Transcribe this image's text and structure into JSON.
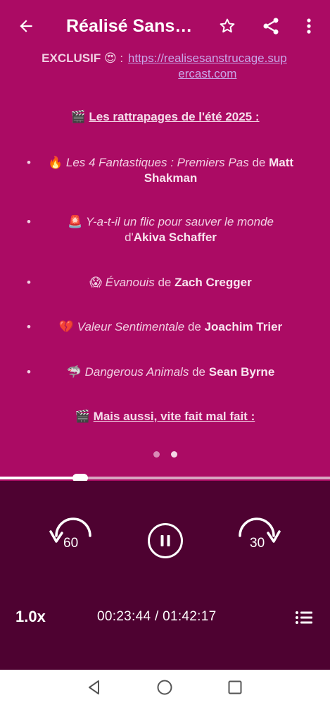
{
  "header": {
    "title": "Réalisé Sans Trucage",
    "back_icon": "arrow-left-icon",
    "favorite_icon": "star-outline-icon",
    "share_icon": "share-icon",
    "more_icon": "more-vertical-icon"
  },
  "description": {
    "exclusive_label": "EXCLUSIF 😍",
    "exclusive_sep": " : ",
    "link_text": "https://realisesanstrucage.supercast.com",
    "heading_emoji": "🎬",
    "heading": "Les rattrapages de l'été 2025 :",
    "items": [
      {
        "emoji": "🔥",
        "title": "Les 4 Fantastiques : Premiers Pas",
        "connector": "de",
        "director": "Matt Shakman"
      },
      {
        "emoji": "🚨",
        "title": "Y-a-t-il un flic pour sauver le monde",
        "connector": "d'",
        "director": "Akiva Schaffer"
      },
      {
        "emoji": "😱",
        "title": "Évanouis",
        "connector": "de",
        "director": "Zach Cregger"
      },
      {
        "emoji": "💔",
        "title": "Valeur Sentimentale",
        "connector": "de",
        "director": "Joachim Trier"
      },
      {
        "emoji": "🦈",
        "title": "Dangerous Animals",
        "connector": "de",
        "director": "Sean Byrne"
      }
    ],
    "heading2_emoji": "🎬",
    "heading2": "Mais aussi, vite fait mal fait :"
  },
  "pager": {
    "count": 2,
    "active_index": 1
  },
  "player": {
    "progress_fraction": 0.2439,
    "rewind_seconds": "60",
    "forward_seconds": "30",
    "speed": "1.0x",
    "current_time": "00:23:44",
    "time_separator": " / ",
    "duration": "01:42:17",
    "playlist_icon": "playlist-icon",
    "pause_icon": "pause-icon"
  },
  "colors": {
    "background": "#ab0b64",
    "player_bg": "#4e0231",
    "link": "#c9a6e8"
  },
  "navbar": {
    "back_icon": "nav-back-icon",
    "home_icon": "nav-home-icon",
    "recents_icon": "nav-recents-icon"
  }
}
